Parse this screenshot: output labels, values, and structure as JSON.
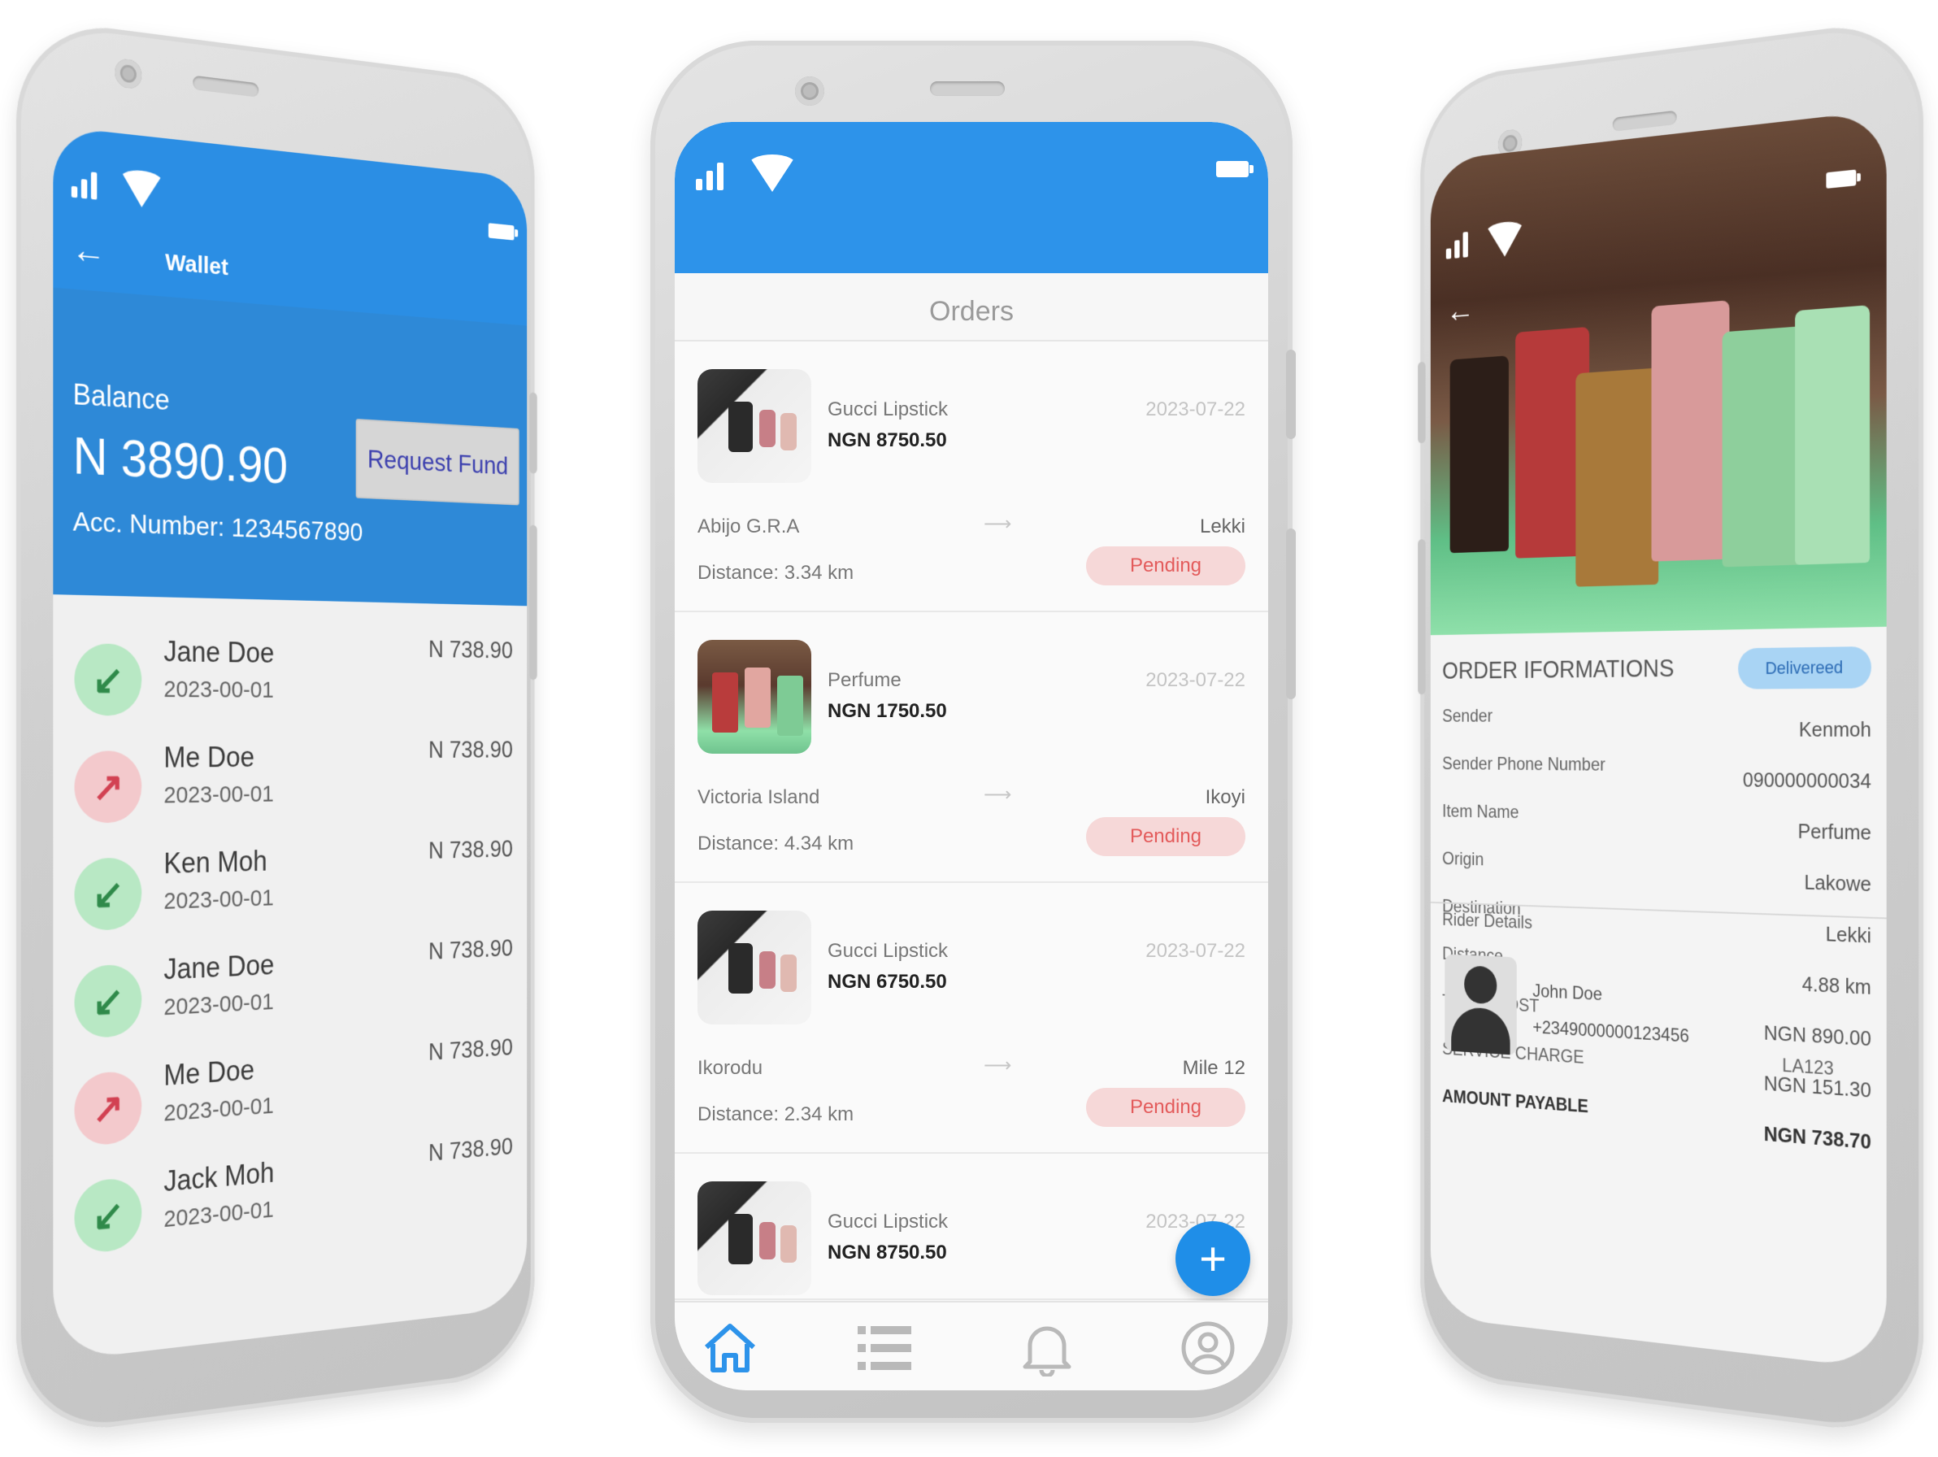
{
  "colors": {
    "primary": "#2d93ea",
    "pending_bg": "#f6d8d8",
    "pending_text": "#e35b5b",
    "incoming": "#2f8a4a",
    "outgoing": "#d24152",
    "delivered_bg": "#a9d4f4"
  },
  "wallet": {
    "title": "Wallet",
    "back_icon": "←",
    "balance_label": "Balance",
    "balance_amount": "N 3890.90",
    "account_number": "Acc. Number: 1234567890",
    "request_button": "Request Fund",
    "transactions": [
      {
        "name": "Jane Doe",
        "date": "2023-00-01",
        "amount": "N 738.90",
        "direction": "incoming",
        "icon": "↙"
      },
      {
        "name": "Me Doe",
        "date": "2023-00-01",
        "amount": "N 738.90",
        "direction": "outgoing",
        "icon": "↗"
      },
      {
        "name": "Ken Moh",
        "date": "2023-00-01",
        "amount": "N 738.90",
        "direction": "incoming",
        "icon": "↙"
      },
      {
        "name": "Jane Doe",
        "date": "2023-00-01",
        "amount": "N 738.90",
        "direction": "incoming",
        "icon": "↙"
      },
      {
        "name": "Me Doe",
        "date": "2023-00-01",
        "amount": "N 738.90",
        "direction": "outgoing",
        "icon": "↗"
      },
      {
        "name": "Jack Moh",
        "date": "2023-00-01",
        "amount": "N 738.90",
        "direction": "incoming",
        "icon": "↙"
      }
    ]
  },
  "orders": {
    "heading": "Orders",
    "arrow": "⟶",
    "fab": "+",
    "items": [
      {
        "title": "Gucci Lipstick",
        "price": "NGN 8750.50",
        "date": "2023-07-22",
        "from": "Abijo G.R.A",
        "to": "Lekki",
        "distance": "Distance: 3.34 km",
        "status": "Pending",
        "thumb": "lipstick"
      },
      {
        "title": "Perfume",
        "price": "NGN 1750.50",
        "date": "2023-07-22",
        "from": "Victoria Island",
        "to": "Ikoyi",
        "distance": "Distance: 4.34 km",
        "status": "Pending",
        "thumb": "perfume"
      },
      {
        "title": "Gucci Lipstick",
        "price": "NGN 6750.50",
        "date": "2023-07-22",
        "from": "Ikorodu",
        "to": "Mile 12",
        "distance": "Distance: 2.34 km",
        "status": "Pending",
        "thumb": "lipstick"
      },
      {
        "title": "Gucci Lipstick",
        "price": "NGN 8750.50",
        "date": "2023-07-22",
        "thumb": "lipstick"
      }
    ],
    "nav": [
      "home-icon",
      "list-icon",
      "bell-icon",
      "profile-icon"
    ]
  },
  "details": {
    "back_icon": "←",
    "heading": "ORDER IFORMATIONS",
    "status": "Delivereed",
    "rows": [
      {
        "label": "Sender",
        "value": "Kenmoh"
      },
      {
        "label": "Sender Phone Number",
        "value": "090000000034"
      },
      {
        "label": "Item Name",
        "value": "Perfume"
      },
      {
        "label": "Origin",
        "value": "Lakowe"
      },
      {
        "label": "Destination",
        "value": "Lekki"
      },
      {
        "label": "Distance",
        "value": "4.88 km"
      },
      {
        "label": "TOTAL COST",
        "value": "NGN 890.00"
      },
      {
        "label": "SERVICE CHARGE",
        "value": "NGN 151.30"
      },
      {
        "label": "AMOUNT PAYABLE",
        "value": "NGN 738.70"
      }
    ],
    "rider_heading": "Rider Details",
    "rider_name": "John Doe",
    "rider_phone": "+2349000000123456",
    "rider_id": "LA123"
  }
}
